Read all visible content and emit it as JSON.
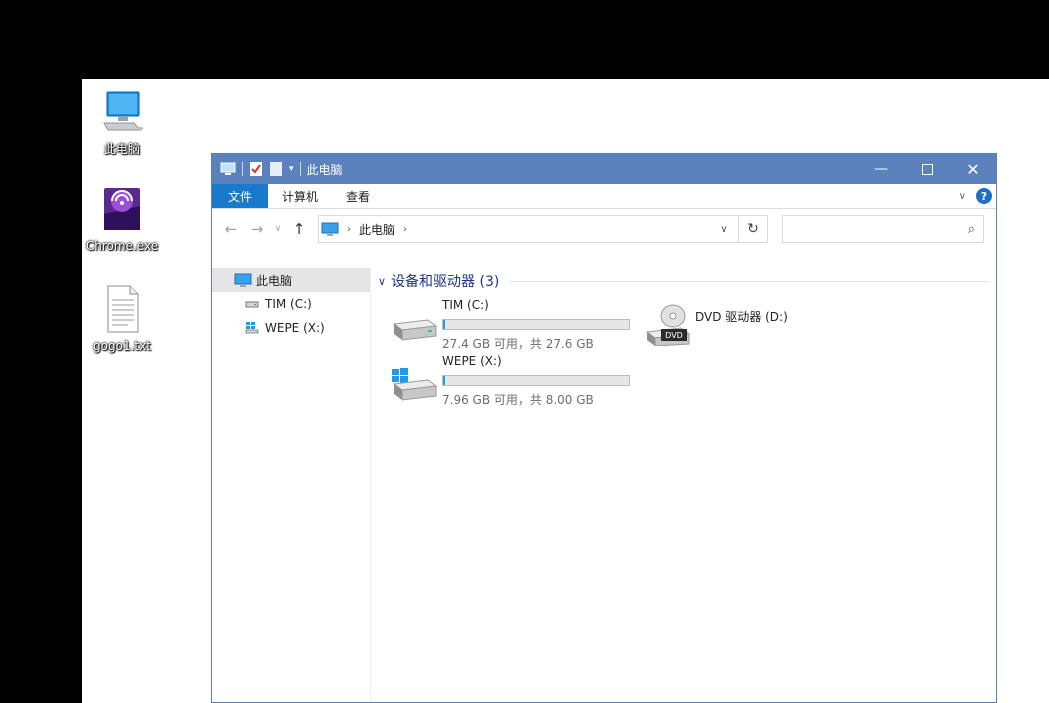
{
  "desktop": {
    "icons": [
      {
        "label": "此电脑",
        "icon": "computer-icon"
      },
      {
        "label": "Chrome.exe",
        "icon": "chrome-exe-icon"
      },
      {
        "label": "gogo1.txt",
        "icon": "text-file-icon"
      }
    ]
  },
  "window": {
    "title": "此电脑",
    "ribbon_tabs": [
      "文件",
      "计算机",
      "查看"
    ],
    "help_label": "?",
    "address": {
      "crumbs": [
        "此电脑"
      ]
    },
    "search": {
      "value": "",
      "placeholder": ""
    },
    "sidebar": {
      "items": [
        {
          "label": "此电脑",
          "icon": "computer-icon",
          "selected": true
        },
        {
          "label": "TIM (C:)",
          "icon": "drive-icon"
        },
        {
          "label": "WEPE (X:)",
          "icon": "windows-drive-icon"
        }
      ]
    },
    "content": {
      "group_title": "设备和驱动器 (3)",
      "drives": [
        {
          "name": "TIM (C:)",
          "info": "27.4 GB 可用，共 27.6 GB",
          "used_fraction": 0.007,
          "icon": "hard-drive-icon"
        },
        {
          "name": "DVD 驱动器 (D:)",
          "icon": "dvd-drive-icon",
          "badge": "DVD"
        },
        {
          "name": "WEPE (X:)",
          "info": "7.96 GB 可用，共 8.00 GB",
          "used_fraction": 0.005,
          "icon": "windows-drive-icon"
        }
      ]
    }
  },
  "colors": {
    "titlebar": "#5b82bd",
    "file_tab": "#1979ca",
    "bar_fill": "#26a0da",
    "group_title": "#1e3287"
  }
}
